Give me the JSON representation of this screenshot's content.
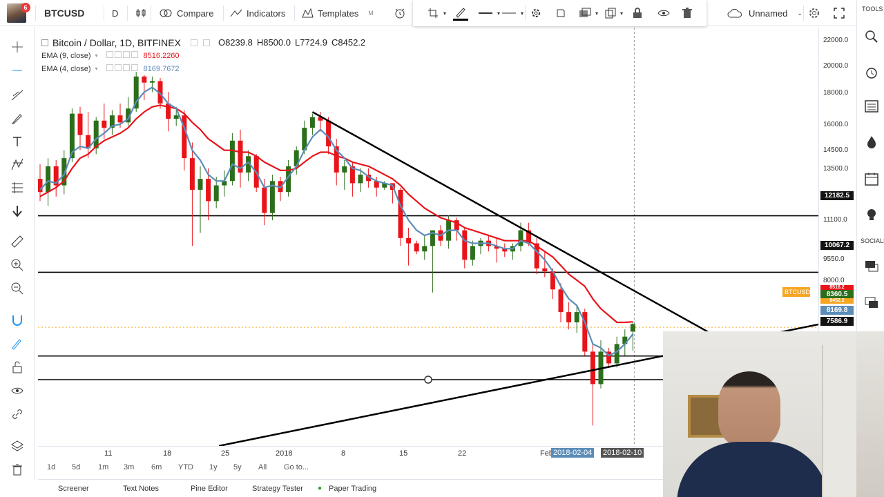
{
  "toolbar": {
    "notification_count": "6",
    "symbol": "BTCUSD",
    "interval": "D",
    "compare_label": "Compare",
    "indicators_label": "Indicators",
    "templates_label": "Templates",
    "templates_hotkey": "M",
    "layout_name": "Unnamed"
  },
  "right_toolbar": {
    "tools_label": "TOOLS",
    "social_label": "SOCIALI"
  },
  "legend": {
    "title": "Bitcoin / Dollar, 1D, BITFINEX",
    "open": "O8239.8",
    "high": "H8500.0",
    "low": "L7724.9",
    "close": "C8452.2",
    "ema9_label": "EMA (9, close)",
    "ema9_value": "8516.2260",
    "ema4_label": "EMA (4, close)",
    "ema4_value": "8169.7672"
  },
  "price_scale": {
    "labels": [
      "22000.0",
      "20000.0",
      "18000.0",
      "16000.0",
      "14500.0",
      "13500.0",
      "11100.0",
      "9550.0",
      "8000.0"
    ],
    "hline_boxes": [
      "12182.5",
      "10067.2",
      "7586.9"
    ],
    "current_price": "8360.5",
    "ema_box": "8169.8",
    "red_box": "8516.2",
    "orange_box": "8452.2",
    "symbol_tag": "BTCUSD"
  },
  "time_scale": {
    "labels": [
      "11",
      "18",
      "25",
      "2018",
      "8",
      "15",
      "22",
      "Feb"
    ],
    "highlight_1": "2018-02-04",
    "highlight_2": "2018-02-10"
  },
  "ranges": [
    "1d",
    "5d",
    "1m",
    "3m",
    "6m",
    "YTD",
    "1y",
    "5y",
    "All",
    "Go to..."
  ],
  "bottom_tabs": [
    "Screener",
    "Text Notes",
    "Pine Editor",
    "Strategy Tester",
    "Paper Trading"
  ],
  "colors": {
    "up": "#2c6e1b",
    "down": "#e8141a",
    "ema9": "#e8141a",
    "ema4": "#5b8db8",
    "trendline": "#000000",
    "accent": "#2196f3"
  },
  "chart_data": {
    "type": "candlestick",
    "candles": [
      {
        "o": 13800,
        "h": 14500,
        "l": 12800,
        "c": 13200
      },
      {
        "o": 13200,
        "h": 14800,
        "l": 12600,
        "c": 14400
      },
      {
        "o": 14400,
        "h": 14700,
        "l": 13000,
        "c": 13500
      },
      {
        "o": 13500,
        "h": 15200,
        "l": 13100,
        "c": 14800
      },
      {
        "o": 14800,
        "h": 17500,
        "l": 14600,
        "c": 17200
      },
      {
        "o": 17200,
        "h": 17600,
        "l": 15200,
        "c": 16000
      },
      {
        "o": 16000,
        "h": 17300,
        "l": 14800,
        "c": 15300
      },
      {
        "o": 15300,
        "h": 17000,
        "l": 15000,
        "c": 16800
      },
      {
        "o": 16800,
        "h": 17800,
        "l": 15800,
        "c": 16400
      },
      {
        "o": 16400,
        "h": 17400,
        "l": 16000,
        "c": 17100
      },
      {
        "o": 17100,
        "h": 17800,
        "l": 16400,
        "c": 16700
      },
      {
        "o": 16700,
        "h": 18200,
        "l": 16500,
        "c": 17500
      },
      {
        "o": 17500,
        "h": 19800,
        "l": 17300,
        "c": 19500
      },
      {
        "o": 19500,
        "h": 19600,
        "l": 18000,
        "c": 19100
      },
      {
        "o": 19100,
        "h": 19500,
        "l": 18500,
        "c": 19200
      },
      {
        "o": 19200,
        "h": 19400,
        "l": 17500,
        "c": 17800
      },
      {
        "o": 17800,
        "h": 18500,
        "l": 16200,
        "c": 16900
      },
      {
        "o": 16900,
        "h": 17600,
        "l": 16500,
        "c": 17100
      },
      {
        "o": 17100,
        "h": 17400,
        "l": 14200,
        "c": 14800
      },
      {
        "o": 14800,
        "h": 15600,
        "l": 11000,
        "c": 13300
      },
      {
        "o": 13300,
        "h": 14400,
        "l": 11500,
        "c": 13800
      },
      {
        "o": 13800,
        "h": 14300,
        "l": 12000,
        "c": 12800
      },
      {
        "o": 12800,
        "h": 13900,
        "l": 12500,
        "c": 13500
      },
      {
        "o": 13500,
        "h": 14200,
        "l": 13000,
        "c": 13700
      },
      {
        "o": 13700,
        "h": 16100,
        "l": 13500,
        "c": 15700
      },
      {
        "o": 15700,
        "h": 16300,
        "l": 13400,
        "c": 14100
      },
      {
        "o": 14100,
        "h": 15200,
        "l": 13700,
        "c": 14900
      },
      {
        "o": 14900,
        "h": 15000,
        "l": 13200,
        "c": 13400
      },
      {
        "o": 13400,
        "h": 13800,
        "l": 11800,
        "c": 12300
      },
      {
        "o": 12300,
        "h": 14000,
        "l": 12000,
        "c": 13700
      },
      {
        "o": 13700,
        "h": 13900,
        "l": 12800,
        "c": 13200
      },
      {
        "o": 13200,
        "h": 14700,
        "l": 13000,
        "c": 14400
      },
      {
        "o": 14400,
        "h": 15400,
        "l": 14000,
        "c": 15200
      },
      {
        "o": 15200,
        "h": 16800,
        "l": 15000,
        "c": 16400
      },
      {
        "o": 16400,
        "h": 17200,
        "l": 16000,
        "c": 17000
      },
      {
        "o": 17000,
        "h": 17300,
        "l": 16200,
        "c": 16800
      },
      {
        "o": 16800,
        "h": 17000,
        "l": 15000,
        "c": 15400
      },
      {
        "o": 15400,
        "h": 15800,
        "l": 13500,
        "c": 14100
      },
      {
        "o": 14100,
        "h": 14700,
        "l": 13300,
        "c": 14400
      },
      {
        "o": 14400,
        "h": 14600,
        "l": 13000,
        "c": 13600
      },
      {
        "o": 13600,
        "h": 14300,
        "l": 13200,
        "c": 14000
      },
      {
        "o": 14000,
        "h": 14300,
        "l": 13400,
        "c": 13700
      },
      {
        "o": 13700,
        "h": 13900,
        "l": 13000,
        "c": 13400
      },
      {
        "o": 13400,
        "h": 13700,
        "l": 13300,
        "c": 13600
      },
      {
        "o": 13600,
        "h": 13600,
        "l": 12700,
        "c": 13300
      },
      {
        "o": 13300,
        "h": 13400,
        "l": 11000,
        "c": 11300
      },
      {
        "o": 11300,
        "h": 11700,
        "l": 10300,
        "c": 11100
      },
      {
        "o": 11100,
        "h": 11200,
        "l": 10700,
        "c": 10800
      },
      {
        "o": 10800,
        "h": 11400,
        "l": 10500,
        "c": 11000
      },
      {
        "o": 11000,
        "h": 11500,
        "l": 9400,
        "c": 11600
      },
      {
        "o": 11600,
        "h": 11800,
        "l": 11000,
        "c": 11200
      },
      {
        "o": 11200,
        "h": 12200,
        "l": 10900,
        "c": 12000
      },
      {
        "o": 12000,
        "h": 12100,
        "l": 11200,
        "c": 11600
      },
      {
        "o": 11600,
        "h": 11700,
        "l": 10200,
        "c": 10500
      },
      {
        "o": 10500,
        "h": 11200,
        "l": 10300,
        "c": 11000
      },
      {
        "o": 11000,
        "h": 11300,
        "l": 10700,
        "c": 11200
      },
      {
        "o": 11200,
        "h": 11400,
        "l": 10800,
        "c": 11000
      },
      {
        "o": 11000,
        "h": 11300,
        "l": 10400,
        "c": 10900
      },
      {
        "o": 10900,
        "h": 11100,
        "l": 10600,
        "c": 10800
      },
      {
        "o": 10800,
        "h": 11100,
        "l": 10500,
        "c": 11000
      },
      {
        "o": 11000,
        "h": 11900,
        "l": 10800,
        "c": 11600
      },
      {
        "o": 11600,
        "h": 11900,
        "l": 11000,
        "c": 11100
      },
      {
        "o": 11100,
        "h": 11300,
        "l": 10000,
        "c": 10200
      },
      {
        "o": 10200,
        "h": 10800,
        "l": 9900,
        "c": 10100
      },
      {
        "o": 10100,
        "h": 10200,
        "l": 9200,
        "c": 9500
      },
      {
        "o": 9500,
        "h": 9700,
        "l": 8500,
        "c": 8800
      },
      {
        "o": 8800,
        "h": 9100,
        "l": 8300,
        "c": 8500
      },
      {
        "o": 8500,
        "h": 9000,
        "l": 8200,
        "c": 8800
      },
      {
        "o": 8800,
        "h": 8900,
        "l": 7600,
        "c": 7700
      },
      {
        "o": 7700,
        "h": 7900,
        "l": 6000,
        "c": 6900
      },
      {
        "o": 6900,
        "h": 8000,
        "l": 6800,
        "c": 7700
      },
      {
        "o": 7700,
        "h": 7800,
        "l": 7300,
        "c": 7400
      },
      {
        "o": 7400,
        "h": 8100,
        "l": 7300,
        "c": 7900
      },
      {
        "o": 7900,
        "h": 8300,
        "l": 7600,
        "c": 8100
      },
      {
        "o": 8239.8,
        "h": 8500,
        "l": 7724.9,
        "c": 8452.2
      }
    ],
    "ema9": [
      13000,
      13200,
      13400,
      13700,
      14300,
      14800,
      15000,
      15400,
      15700,
      15900,
      16100,
      16400,
      16900,
      17300,
      17600,
      17700,
      17600,
      17500,
      17200,
      16700,
      16300,
      15800,
      15500,
      15200,
      15200,
      15100,
      15100,
      14900,
      14600,
      14400,
      14200,
      14200,
      14300,
      14600,
      14900,
      15100,
      15100,
      14900,
      14800,
      14600,
      14500,
      14400,
      14200,
      14000,
      13800,
      13500,
      13100,
      12800,
      12500,
      12300,
      12100,
      12000,
      11900,
      11700,
      11600,
      11500,
      11400,
      11300,
      11200,
      11200,
      11200,
      11200,
      11000,
      10800,
      10600,
      10300,
      10000,
      9800,
      9600,
      9200,
      8900,
      8700,
      8500,
      8500,
      8516
    ],
    "ema4": [
      13300,
      13700,
      13600,
      14000,
      15100,
      15400,
      15300,
      15800,
      16100,
      16500,
      16600,
      16900,
      17900,
      18500,
      18800,
      18400,
      17800,
      17500,
      16400,
      15200,
      14700,
      14000,
      13700,
      13700,
      14500,
      14300,
      14600,
      14100,
      13400,
      13500,
      13400,
      13900,
      14400,
      15200,
      15900,
      16300,
      15900,
      15200,
      14800,
      14300,
      14200,
      13900,
      13700,
      13600,
      13500,
      12600,
      12000,
      11600,
      11400,
      11500,
      11400,
      11600,
      11600,
      11200,
      11100,
      11100,
      11100,
      11000,
      10900,
      10900,
      11200,
      11100,
      10800,
      10500,
      10100,
      9600,
      9200,
      9000,
      8500,
      7900,
      7800,
      7600,
      7700,
      7900,
      8170
    ],
    "horizontal_lines": [
      12182.5,
      10067.2,
      7586.9
    ],
    "ylim": [
      5600,
      23000
    ]
  }
}
